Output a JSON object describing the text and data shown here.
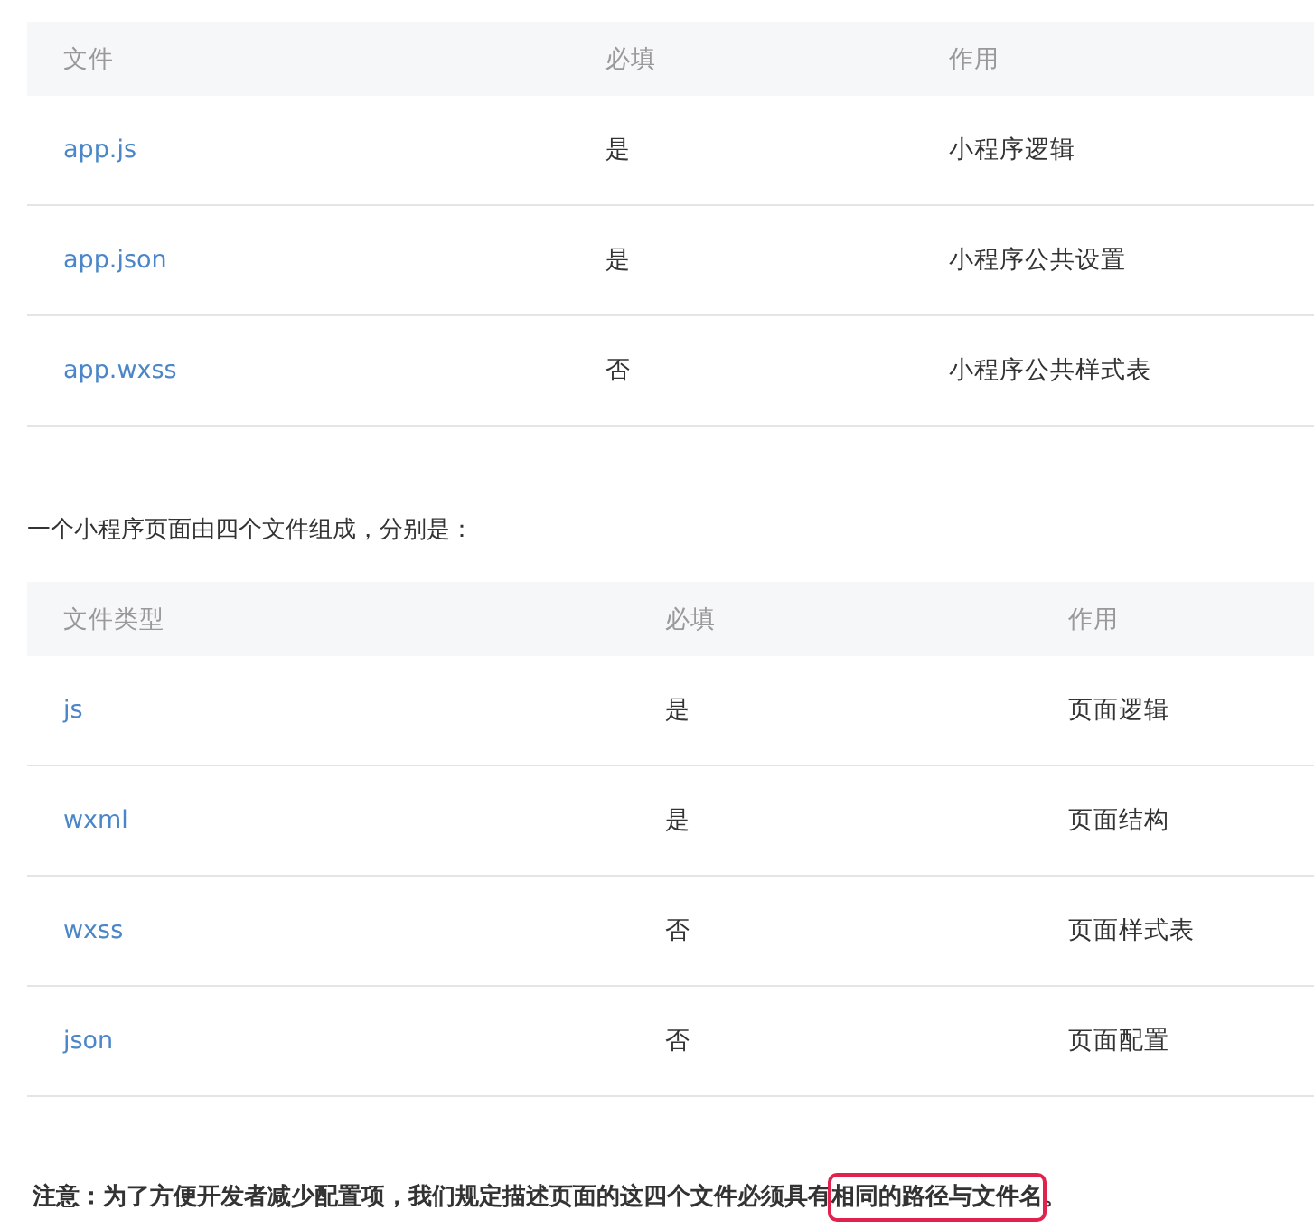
{
  "tables": [
    {
      "columns": [
        "文件",
        "必填",
        "作用"
      ],
      "rows": [
        [
          "app.js",
          "是",
          "小程序逻辑"
        ],
        [
          "app.json",
          "是",
          "小程序公共设置"
        ],
        [
          "app.wxss",
          "否",
          "小程序公共样式表"
        ]
      ]
    },
    {
      "intro": "一个小程序页面由四个文件组成，分别是：",
      "columns": [
        "文件类型",
        "必填",
        "作用"
      ],
      "rows": [
        [
          "js",
          "是",
          "页面逻辑"
        ],
        [
          "wxml",
          "是",
          "页面结构"
        ],
        [
          "wxss",
          "否",
          "页面样式表"
        ],
        [
          "json",
          "否",
          "页面配置"
        ]
      ]
    }
  ],
  "note": {
    "parts": [
      {
        "text": "注意：为了方便开发者减少配置项，我们规定描述页面的这四个文件必须具有",
        "marked": false
      },
      {
        "text": "相同的路径与文件名",
        "marked": true
      },
      {
        "text": "。",
        "marked": false
      }
    ]
  }
}
